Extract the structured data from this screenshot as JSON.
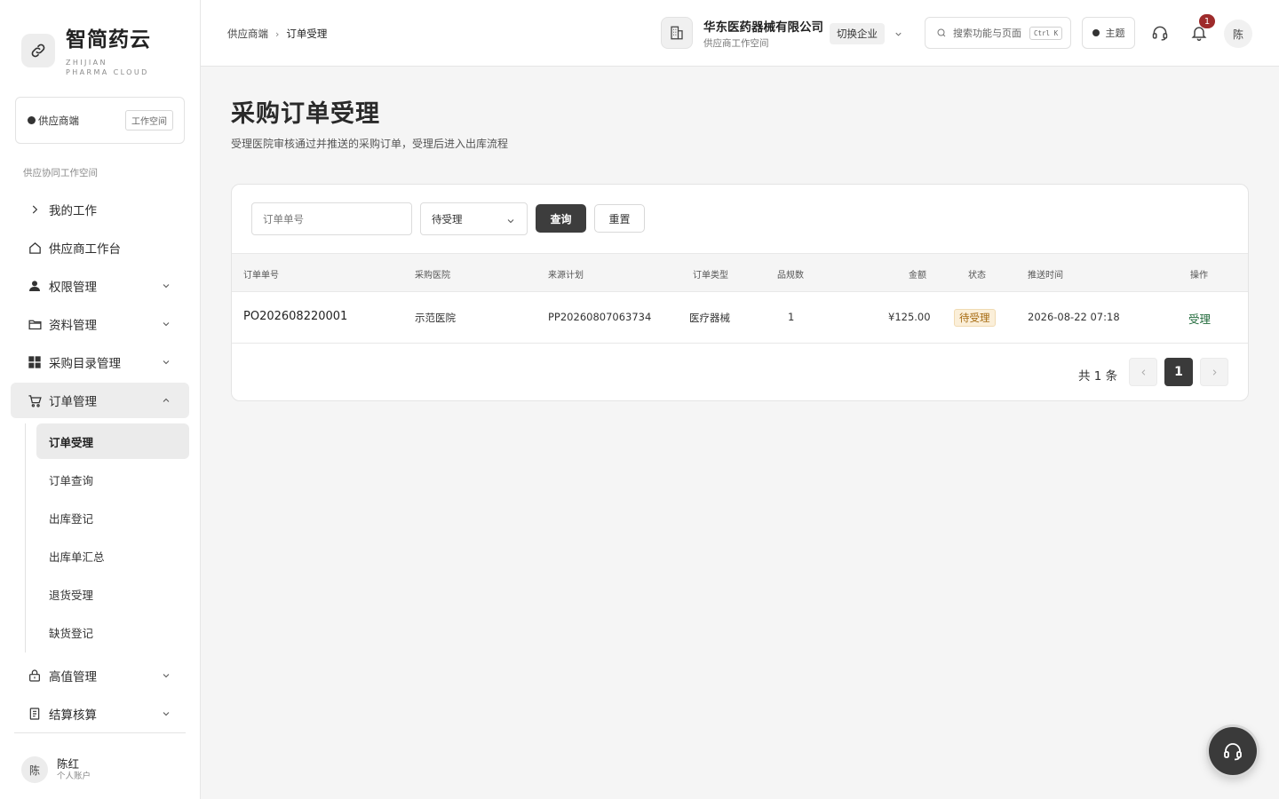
{
  "brand": {
    "name": "智简药云",
    "sub": "ZHIJIAN PHARMA CLOUD",
    "logo_icon": "link-icon"
  },
  "workspace": {
    "name": "供应商端",
    "tag": "工作空间"
  },
  "sidebar": {
    "section_label": "供应协同工作空间",
    "items": [
      {
        "label": "我的工作",
        "icon": "chevron-right-icon"
      },
      {
        "label": "供应商工作台",
        "icon": "home-icon"
      },
      {
        "label": "权限管理",
        "icon": "user-icon"
      },
      {
        "label": "资料管理",
        "icon": "folder-icon"
      },
      {
        "label": "采购目录管理",
        "icon": "grid-icon"
      },
      {
        "label": "订单管理",
        "icon": "cart-icon"
      },
      {
        "label": "高值管理",
        "icon": "lock-icon"
      },
      {
        "label": "结算核算",
        "icon": "document-icon"
      }
    ],
    "sub_items": [
      {
        "label": "订单受理"
      },
      {
        "label": "订单查询"
      },
      {
        "label": "出库登记"
      },
      {
        "label": "出库单汇总"
      },
      {
        "label": "退货受理"
      },
      {
        "label": "缺货登记"
      }
    ]
  },
  "user": {
    "avatar": "陈",
    "name": "陈红",
    "role": "个人账户"
  },
  "header": {
    "breadcrumb": [
      "供应商端",
      "订单受理"
    ],
    "org_name": "华东医药器械有限公司",
    "org_sub": "供应商工作空间",
    "switch_label": "切换企业",
    "search_placeholder": "搜索功能与页面",
    "search_shortcut": "Ctrl K",
    "theme_label": "主题",
    "notification_count": "1",
    "avatar": "陈"
  },
  "page": {
    "title": "采购订单受理",
    "description": "受理医院审核通过并推送的采购订单，受理后进入出库流程"
  },
  "filters": {
    "order_no_placeholder": "订单单号",
    "status_value": "待受理",
    "query_label": "查询",
    "reset_label": "重置"
  },
  "table": {
    "columns": [
      "订单单号",
      "采购医院",
      "来源计划",
      "订单类型",
      "品规数",
      "金额",
      "状态",
      "推送时间",
      "操作"
    ],
    "rows": [
      {
        "order_no": "PO202608220001",
        "hospital": "示范医院",
        "plan": "PP20260807063734",
        "type": "医疗器械",
        "sku_count": "1",
        "amount": "¥125.00",
        "status": "待受理",
        "push_time": "2026-08-22 07:18",
        "action": "受理"
      }
    ]
  },
  "pagination": {
    "total": "共 1 条",
    "current": "1"
  },
  "colors": {
    "primary": "#3d3d3d",
    "status_pending": "#a66a10",
    "action": "#226b3c",
    "badge": "#9e2b2b"
  }
}
